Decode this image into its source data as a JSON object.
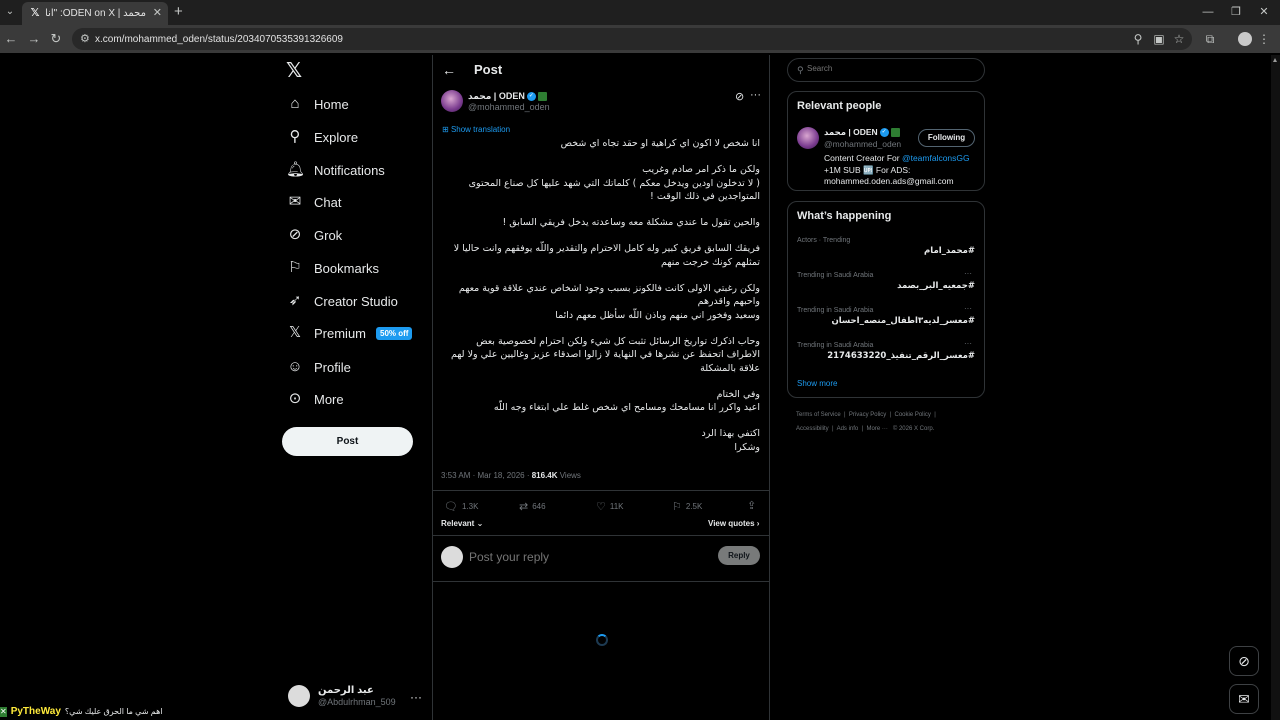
{
  "browser": {
    "tab_title": "محمد | ODEN on X: \"انا شخص لا",
    "address": "x.com/mohammed_oden/status/2034070535391326609"
  },
  "nav": {
    "items": [
      {
        "label": "Home",
        "icon": "home-icon",
        "glyph": "⌂"
      },
      {
        "label": "Explore",
        "icon": "search-icon",
        "glyph": "⚲"
      },
      {
        "label": "Notifications",
        "icon": "bell-icon",
        "glyph": "🔔︎"
      },
      {
        "label": "Chat",
        "icon": "mail-icon",
        "glyph": "✉"
      },
      {
        "label": "Grok",
        "icon": "grok-icon",
        "glyph": "⊘"
      },
      {
        "label": "Bookmarks",
        "icon": "bookmark-icon",
        "glyph": "⚐"
      },
      {
        "label": "Creator Studio",
        "icon": "rocket-icon",
        "glyph": "➶"
      },
      {
        "label": "Premium",
        "icon": "x-premium-icon",
        "glyph": "𝕏"
      },
      {
        "label": "Profile",
        "icon": "person-icon",
        "glyph": "☺"
      },
      {
        "label": "More",
        "icon": "more-circle-icon",
        "glyph": "⊙"
      }
    ],
    "premium_badge": "50% off",
    "post_button": "Post",
    "account_name": "عبد الرحمن",
    "account_handle": "@Abdulrhman_509"
  },
  "post": {
    "header_title": "Post",
    "author_name": "محمد | ODEN",
    "author_handle": "@mohammed_oden",
    "show_translation": "Show translation",
    "paragraphs": [
      "انا شخص لا اكون اي كراهية او حقد تجاه اي شخص",
      "ولكن ما ذكر امر صادم وغريب\n( لا تدخلون اودين ويدخل معكم ) كلماتك التي شهد عليها كل صناع المحتوى المتواجدين في ذلك الوقت !",
      "والحين تقول ما عندي مشكلة معه وساعدته يدخل فريقي السابق !",
      "فريقك السابق فريق كبير وله كامل الاحترام والتقدير واللّه يوفقهم وانت حاليا لا تمثلهم كونك خرجت منهم",
      "ولكن رغبتي الاولى كانت فالكونز بسبب وجود اشخاص عندي علاقة قوية معهم واحبهم واقدرهم\nوسعيد وفخور اني منهم وباذن اللّه سأظل معهم دائما",
      "وحاب اذكرك تواريخ الرسائل تثبت كل شيء ولكن احترام لخصوصية بعض الاطراف اتحفظ عن نشرها في النهاية لا زالوا اصدقاء عزيز وغاليين علي ولا لهم علاقة بالمشكلة",
      "وفي الختام\nاعيد واكرر انا مسامحك ومسامح اي شخص غلط علي  ابتغاء وجه اللّه",
      "اكتفي بهذا الرد\nوشكرا"
    ],
    "time": "3:53 AM · Mar 18, 2026 · ",
    "views_count": "816.4K",
    "views_label": " Views",
    "replies": "1.3K",
    "reposts": "646",
    "likes": "11K",
    "bookmarks": "2.5K",
    "relevant_label": "Relevant",
    "view_quotes": "View quotes",
    "reply_placeholder": "Post your reply",
    "reply_button": "Reply"
  },
  "sidebar": {
    "search_placeholder": "Search",
    "relevant_title": "Relevant people",
    "person_name": "محمد | ODEN",
    "person_handle": "@mohammed_oden",
    "following_button": "Following",
    "bio_prefix": "Content Creator For ",
    "bio_mention": "@teamfalconsGG",
    "bio_line2": "+1M SUB 🆙 For ADS:",
    "bio_line3": "mohammed.oden.ads@gmail.com",
    "happening_title": "What’s happening",
    "trends": [
      {
        "meta": "Actors · Trending",
        "name": "#محمد_امام"
      },
      {
        "meta": "Trending in Saudi Arabia",
        "name": "#جمعيه_البر_بصمد"
      },
      {
        "meta": "Trending in Saudi Arabia",
        "name": "#معسر_لديه٣اطفال_منصه_احسان"
      },
      {
        "meta": "Trending in Saudi Arabia",
        "name": "#معسر_الرقم_تنفيذ_2174633220"
      }
    ],
    "show_more": "Show more",
    "footer": {
      "terms": "Terms of Service",
      "privacy": "Privacy Policy",
      "cookie": "Cookie Policy",
      "accessibility": "Accessibility",
      "ads": "Ads info",
      "more": "More ···",
      "copyright": "© 2026 X Corp."
    }
  },
  "overlay": {
    "brand": "PyTheWay",
    "text": "اهم شي ما الحرق عليك شي؟"
  }
}
